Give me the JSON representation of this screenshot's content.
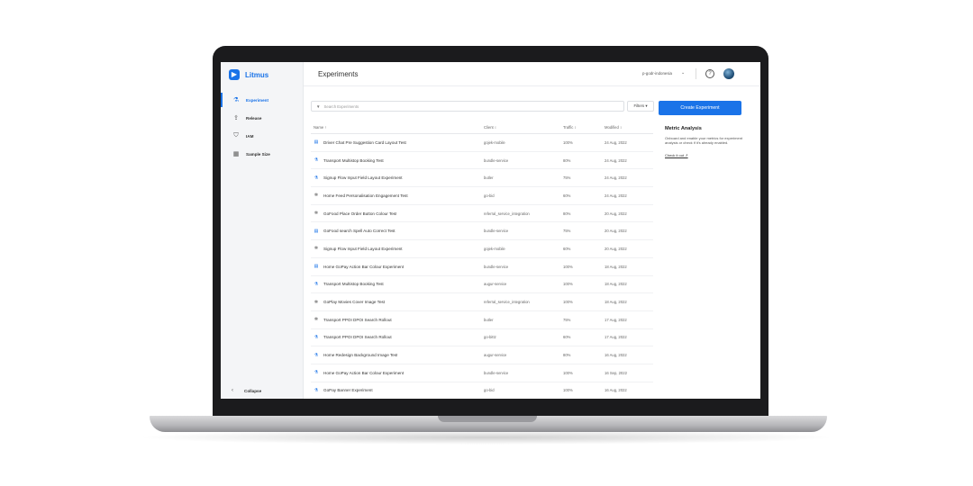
{
  "app": {
    "name": "Litmus",
    "logo_glyph": "▶",
    "accent": "#1a73e8"
  },
  "sidebar": {
    "items": [
      {
        "label": "Experiment",
        "icon": "flask-icon",
        "glyph": "⚗",
        "active": true
      },
      {
        "label": "Release",
        "icon": "rocket-icon",
        "glyph": "⇪",
        "active": false
      },
      {
        "label": "IAM",
        "icon": "shield-icon",
        "glyph": "⛉",
        "active": false
      },
      {
        "label": "Sample Size",
        "icon": "calculator-icon",
        "glyph": "▦",
        "active": false
      }
    ],
    "collapse_label": "Collapse",
    "collapse_glyph": "‹"
  },
  "header": {
    "title": "Experiments",
    "org": "p-godr-indonesia",
    "org_chevron": "⌄",
    "help_glyph": "?"
  },
  "toolbar": {
    "search_icon": "▼",
    "search_placeholder": "Search Experiments",
    "filters_label": "Filters ▾",
    "create_label": "Create Experiment"
  },
  "table": {
    "columns": [
      "Name ↑",
      "Client ↕",
      "Traffic ↕",
      "Modified ↕"
    ],
    "rows": [
      {
        "icon": "doc",
        "name": "Driver Chat Pre Suggestion Card Layout Test",
        "client": "gojek-mobile",
        "traffic": "100%",
        "modified": "24 Aug, 2022"
      },
      {
        "icon": "flask",
        "name": "Transport Multistop Booking Test",
        "client": "bundle-service",
        "traffic": "80%",
        "modified": "24 Aug, 2022"
      },
      {
        "icon": "flask",
        "name": "Signup Flow Input Field Layout Experiment",
        "client": "butler",
        "traffic": "75%",
        "modified": "24 Aug, 2022"
      },
      {
        "icon": "gear",
        "name": "Home Feed Personalisation Engagement Test",
        "client": "go-bid",
        "traffic": "60%",
        "modified": "24 Aug, 2022"
      },
      {
        "icon": "gear",
        "name": "GoFood Place Order Button Colour Test",
        "client": "referral_service_integration",
        "traffic": "80%",
        "modified": "20 Aug, 2022"
      },
      {
        "icon": "doc",
        "name": "GoFood search Spell Auto Correct Test",
        "client": "bundle-service",
        "traffic": "75%",
        "modified": "20 Aug, 2022"
      },
      {
        "icon": "gear",
        "name": "Signup Flow Input Field Layout Experiment",
        "client": "gojek-mobile",
        "traffic": "60%",
        "modified": "20 Aug, 2022"
      },
      {
        "icon": "doc",
        "name": "Home GoPay Action Bar Colour Experiment",
        "client": "bundle-service",
        "traffic": "100%",
        "modified": "18 Aug, 2022"
      },
      {
        "icon": "flask",
        "name": "Transport Multistop Booking Test",
        "client": "augur-service",
        "traffic": "100%",
        "modified": "18 Aug, 2022"
      },
      {
        "icon": "gear",
        "name": "GoPlay Movies Cover Image Test",
        "client": "referral_service_integration",
        "traffic": "100%",
        "modified": "18 Aug, 2022"
      },
      {
        "icon": "gear",
        "name": "Transport PPOI DPOI Search Rollout",
        "client": "butler",
        "traffic": "75%",
        "modified": "17 Aug, 2022"
      },
      {
        "icon": "flask",
        "name": "Transport PPOI DPOI Search Rollout",
        "client": "go-bittz",
        "traffic": "60%",
        "modified": "17 Aug, 2022"
      },
      {
        "icon": "flask",
        "name": "Home Redesign Background Image Test",
        "client": "augur-service",
        "traffic": "80%",
        "modified": "16 Aug, 2022"
      },
      {
        "icon": "flask",
        "name": "Home GoPay Action Bar Colour Experiment",
        "client": "bundle-service",
        "traffic": "100%",
        "modified": "16 Sep, 2022"
      },
      {
        "icon": "flask",
        "name": "GoPay Banner Experiment",
        "client": "go-bid",
        "traffic": "100%",
        "modified": "16 Aug, 2022"
      }
    ]
  },
  "metric": {
    "title": "Metric Analysis",
    "description": "Onboard and enable your metrics for experiment analysis or check if it's already enabled.",
    "link": "Check it out ↗"
  }
}
